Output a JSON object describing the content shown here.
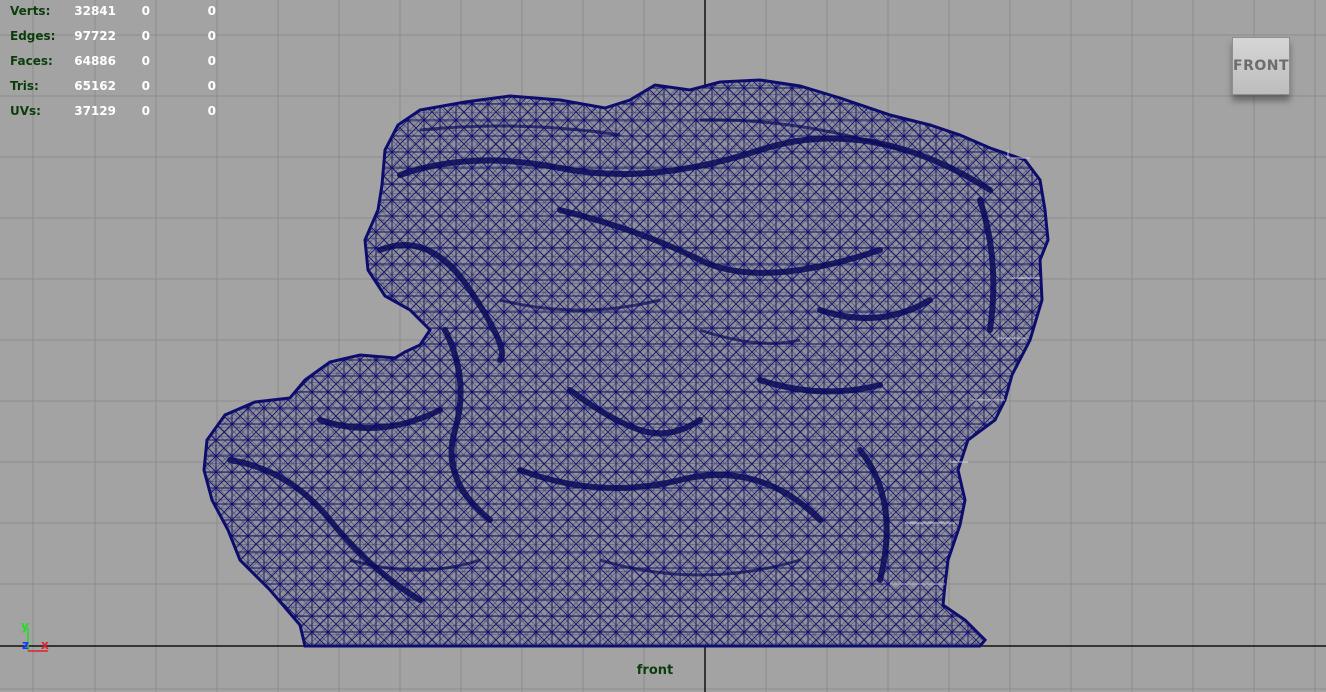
{
  "hud": {
    "rows": [
      {
        "label": "Verts:",
        "v1": "32841",
        "v2": "0",
        "v3": "0"
      },
      {
        "label": "Edges:",
        "v1": "97722",
        "v2": "0",
        "v3": "0"
      },
      {
        "label": "Faces:",
        "v1": "64886",
        "v2": "0",
        "v3": "0"
      },
      {
        "label": "Tris:",
        "v1": "65162",
        "v2": "0",
        "v3": "0"
      },
      {
        "label": "UVs:",
        "v1": "37129",
        "v2": "0",
        "v3": "0"
      }
    ]
  },
  "view_cube": {
    "label": "FRONT"
  },
  "camera_label": "front",
  "axis": {
    "y": "y",
    "z": "z",
    "x": "x"
  },
  "colors": {
    "background": "#a3a3a3",
    "grid": "#8a8a8a",
    "axis_line": "#111111",
    "wireframe": "#0d0d6e",
    "hud_label": "#0b3d0b",
    "hud_value": "#ffffff",
    "axis_x": "#e0202a",
    "axis_y": "#22dd22",
    "axis_z": "#2233ff"
  },
  "mesh": {
    "name": "rock-mesh",
    "display": "wireframe-on-shaded"
  }
}
